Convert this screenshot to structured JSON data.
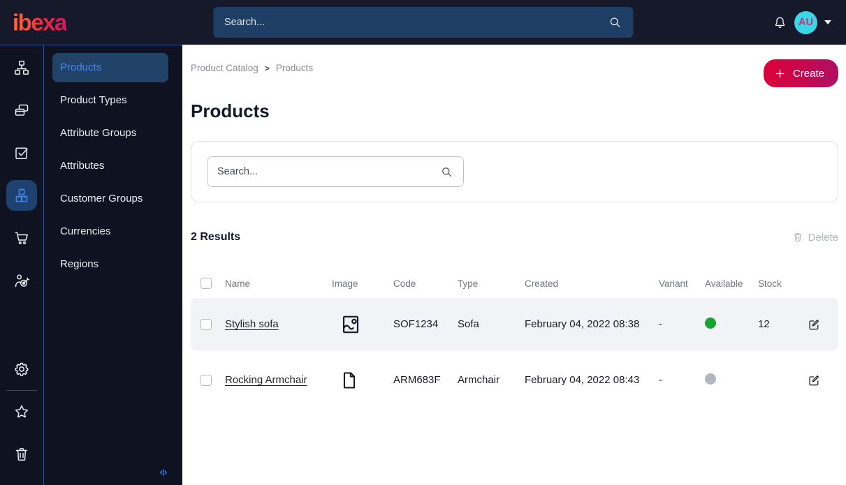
{
  "topbar": {
    "logo": "ibexa",
    "search_placeholder": "Search...",
    "avatar_initials": "AU",
    "icons": [
      "bell-icon",
      "caret-down-icon"
    ]
  },
  "rail": {
    "icons": [
      "content-tree-icon",
      "pages-icon",
      "tasks-check-icon",
      "products-boxes-icon",
      "commerce-cart-icon",
      "personalization-target-icon"
    ],
    "active_icon": "products-boxes-icon",
    "bottom_icons": [
      "settings-gear-icon",
      "bookmarks-star-icon",
      "trash-icon",
      "collapse-panel-icon"
    ]
  },
  "sidebar": {
    "items": [
      {
        "label": "Products",
        "active": true
      },
      {
        "label": "Product Types",
        "active": false
      },
      {
        "label": "Attribute Groups",
        "active": false
      },
      {
        "label": "Attributes",
        "active": false
      },
      {
        "label": "Customer Groups",
        "active": false
      },
      {
        "label": "Currencies",
        "active": false
      },
      {
        "label": "Regions",
        "active": false
      }
    ]
  },
  "main": {
    "breadcrumb": {
      "parent": "Product Catalog",
      "separator": ">",
      "current": "Products"
    },
    "create_button": {
      "label": "Create",
      "icon": "plus-icon"
    },
    "title": "Products",
    "filter": {
      "search_placeholder": "Search...",
      "icon": "search-icon"
    },
    "results": {
      "count": "2 Results"
    },
    "delete_button": {
      "label": "Delete",
      "icon": "trash-icon",
      "disabled": true
    },
    "table": {
      "headers": [
        "Name",
        "Image",
        "Code",
        "Type",
        "Created",
        "Variant",
        "Available",
        "Stock"
      ],
      "rows": [
        {
          "name": "Stylish sofa",
          "image_icon": "image-icon",
          "code": "SOF1234",
          "type": "Sofa",
          "created": "February 04, 2022 08:38",
          "variant": "-",
          "available_color": "#12a52f",
          "stock": "12"
        },
        {
          "name": "Rocking Armchair",
          "image_icon": "file-icon",
          "code": "ARM683F",
          "type": "Armchair",
          "created": "February 04, 2022 08:43",
          "variant": "-",
          "available_color": "#b2b5bd",
          "stock": ""
        }
      ]
    }
  },
  "colors": {
    "topbar_bg": "#151929",
    "panel_bg": "#0f1220",
    "accent_line": "#31508d",
    "selected_item_bg": "#224368",
    "selected_item_text": "#4586f0",
    "topbar_search_bg": "#1f3e66",
    "create_gradient_start": "#dc0238",
    "create_gradient_end": "#b00f63",
    "avatar_bg": "#38d6e6",
    "avatar_text": "#cc2f7b",
    "available_on": "#12a52f",
    "available_off": "#b2b5bd",
    "row_shade": "#f2f3f6"
  }
}
